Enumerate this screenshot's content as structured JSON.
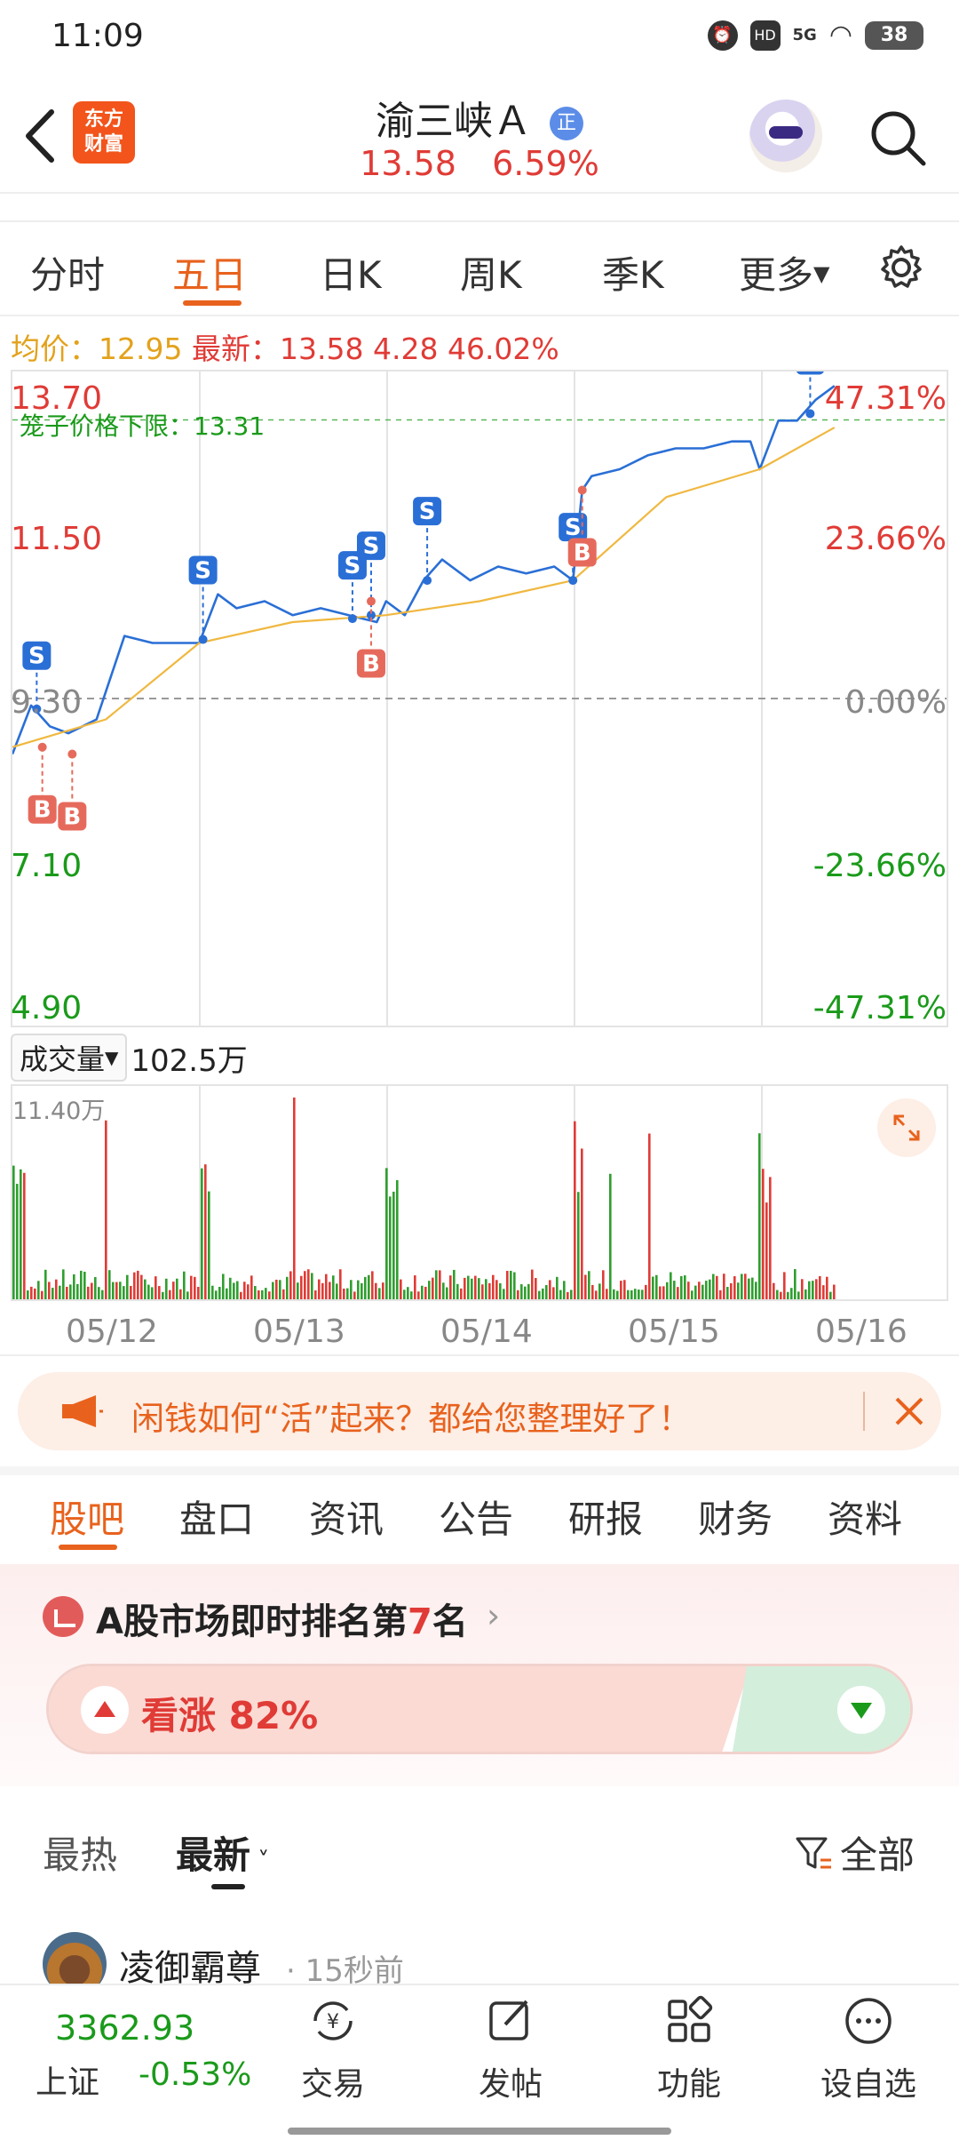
{
  "status_bar": {
    "time": "11:09",
    "network": "5G",
    "battery": "38"
  },
  "header": {
    "app_logo": "东方\n财富",
    "stock_name": "渝三峡Ａ",
    "badge": "正",
    "price": "13.58",
    "change_pct": "6.59%"
  },
  "chart_tabs": [
    "分时",
    "五日",
    "日K",
    "周K",
    "季K",
    "更多"
  ],
  "active_chart_tab": "五日",
  "info_line": {
    "avg_label": "均价：",
    "avg_value": "12.95",
    "last_label": "最新：",
    "last_value": "13.58",
    "change": "4.28",
    "change_pct": "46.02%"
  },
  "cage_limit": "笼子价格下限：13.31",
  "chart_data": {
    "type": "line",
    "x_days": [
      "05/12",
      "05/13",
      "05/14",
      "05/15",
      "05/16"
    ],
    "price_axis": [
      "13.70",
      "11.50",
      "9.30",
      "7.10",
      "4.90"
    ],
    "pct_axis": [
      "47.31%",
      "23.66%",
      "0.00%",
      "-23.66%",
      "-47.31%"
    ],
    "ylim": [
      4.9,
      13.7
    ],
    "prev_close": 9.3,
    "series": [
      {
        "name": "价格",
        "color": "#2a6fd6",
        "x": [
          0.0,
          0.1,
          0.2,
          0.3,
          0.45,
          0.6,
          0.75,
          0.9,
          1.0,
          1.1,
          1.2,
          1.35,
          1.5,
          1.65,
          1.8,
          1.95,
          2.0,
          2.1,
          2.2,
          2.3,
          2.45,
          2.6,
          2.75,
          2.9,
          3.0,
          3.05,
          3.1,
          3.25,
          3.4,
          3.55,
          3.7,
          3.85,
          3.95,
          4.0,
          4.1,
          4.2,
          4.3,
          4.4
        ],
        "values": [
          8.5,
          9.2,
          8.9,
          8.8,
          9.0,
          10.2,
          10.1,
          10.1,
          10.1,
          10.8,
          10.6,
          10.7,
          10.5,
          10.6,
          10.5,
          10.4,
          10.7,
          10.5,
          11.0,
          11.3,
          11.0,
          11.2,
          11.1,
          11.2,
          11.0,
          12.3,
          12.5,
          12.6,
          12.8,
          12.9,
          12.9,
          13.0,
          13.0,
          12.6,
          13.3,
          13.3,
          13.6,
          13.8
        ]
      },
      {
        "name": "均价",
        "color": "#f0b840",
        "x": [
          0.0,
          0.5,
          1.0,
          1.5,
          2.0,
          2.5,
          3.0,
          3.5,
          4.0,
          4.4
        ],
        "values": [
          8.6,
          9.0,
          10.1,
          10.4,
          10.5,
          10.7,
          11.0,
          12.2,
          12.6,
          13.2
        ]
      }
    ],
    "markers": [
      {
        "type": "S",
        "x": 0.13,
        "y": 9.15
      },
      {
        "type": "B",
        "x": 0.16,
        "y": 8.6
      },
      {
        "type": "B",
        "x": 0.32,
        "y": 8.5
      },
      {
        "type": "S",
        "x": 1.02,
        "y": 10.15
      },
      {
        "type": "S",
        "x": 1.82,
        "y": 10.45
      },
      {
        "type": "S",
        "x": 1.92,
        "y": 10.5
      },
      {
        "type": "B",
        "x": 1.92,
        "y": 10.7
      },
      {
        "type": "S",
        "x": 2.22,
        "y": 11.0
      },
      {
        "type": "S",
        "x": 3.0,
        "y": 11.0
      },
      {
        "type": "B",
        "x": 3.05,
        "y": 12.3
      },
      {
        "type": "S",
        "x": 4.27,
        "y": 13.4
      }
    ]
  },
  "volume": {
    "selector": "成交量",
    "value": "102.5万",
    "max_label": "11.40万"
  },
  "banner": {
    "text": "闲钱如何“活”起来？都给您整理好了！"
  },
  "info_tabs": [
    "股吧",
    "盘口",
    "资讯",
    "公告",
    "研报",
    "财务",
    "资料"
  ],
  "active_info_tab": "股吧",
  "ranking": {
    "prefix": "A股市场即时排名第",
    "rank": "7",
    "suffix": "名"
  },
  "vote": {
    "up_label": "看涨 82%",
    "up_pct": 0.82
  },
  "post_filters": {
    "hot": "最热",
    "latest": "最新",
    "all": "全部"
  },
  "post": {
    "username": "凌御霸尊",
    "time": "15秒前"
  },
  "bottom_nav": {
    "index_value": "3362.93",
    "index_name": "上证",
    "index_change": "-0.53%",
    "items": [
      "交易",
      "发帖",
      "功能",
      "设自选"
    ]
  }
}
